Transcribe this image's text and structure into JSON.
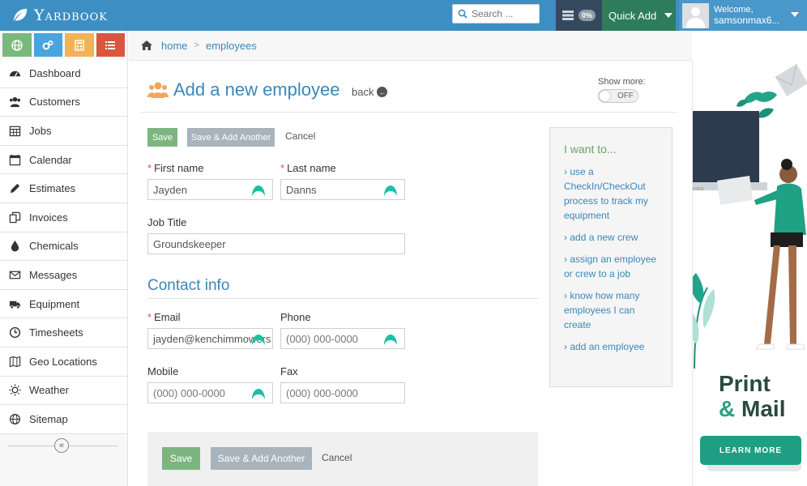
{
  "header": {
    "logo_text": "Yardbook",
    "search_placeholder": "Search ...",
    "notif_badge": "0%",
    "quick_add": "Quick Add",
    "welcome": "Welcome,",
    "username": "samsonmax6..."
  },
  "quick_icons": [
    {
      "name": "globe-icon",
      "color": "#7ab87c"
    },
    {
      "name": "cogs-icon",
      "color": "#4aa4dd"
    },
    {
      "name": "calculator-icon",
      "color": "#f2b356"
    },
    {
      "name": "list-icon",
      "color": "#d8573f"
    }
  ],
  "sidebar": {
    "items": [
      {
        "label": "Dashboard",
        "icon": "dashboard-icon"
      },
      {
        "label": "Customers",
        "icon": "users-icon"
      },
      {
        "label": "Jobs",
        "icon": "calendar-grid-icon"
      },
      {
        "label": "Calendar",
        "icon": "calendar-icon"
      },
      {
        "label": "Estimates",
        "icon": "pencil-icon"
      },
      {
        "label": "Invoices",
        "icon": "copy-icon"
      },
      {
        "label": "Chemicals",
        "icon": "drop-icon"
      },
      {
        "label": "Messages",
        "icon": "envelope-icon"
      },
      {
        "label": "Equipment",
        "icon": "truck-icon"
      },
      {
        "label": "Timesheets",
        "icon": "clock-icon"
      },
      {
        "label": "Geo Locations",
        "icon": "map-icon"
      },
      {
        "label": "Weather",
        "icon": "sun-icon"
      },
      {
        "label": "Sitemap",
        "icon": "globe-icon"
      }
    ],
    "collapse_glyph": "«"
  },
  "breadcrumb": {
    "home": "home",
    "separator": ">",
    "current": "employees"
  },
  "page": {
    "title": "Add a new employee",
    "back": "back",
    "back_glyph": "←",
    "show_more": "Show more:",
    "toggle": "OFF"
  },
  "form": {
    "save": "Save",
    "save_another": "Save & Add Another",
    "cancel": "Cancel",
    "required_mark": "*",
    "first_name_label": "First name",
    "first_name_value": "Jayden",
    "last_name_label": "Last name",
    "last_name_value": "Danns",
    "job_title_label": "Job Title",
    "job_title_value": "Groundskeeper",
    "contact_title": "Contact info",
    "email_label": "Email",
    "email_value": "jayden@kenchimmowers",
    "phone_label": "Phone",
    "phone_placeholder": "(000) 000-0000",
    "mobile_label": "Mobile",
    "mobile_placeholder": "(000) 000-0000",
    "fax_label": "Fax",
    "fax_placeholder": "(000) 000-0000"
  },
  "i_want": {
    "title": "I want to...",
    "links": [
      "use a CheckIn/CheckOut process to track my equipment",
      "add a new crew",
      "assign an employee or crew to a job",
      "know how many employees I can create",
      "add an employee"
    ]
  },
  "ad": {
    "line1": "Print",
    "line2_amp": "&",
    "line2": "Mail",
    "button": "LEARN MORE"
  }
}
